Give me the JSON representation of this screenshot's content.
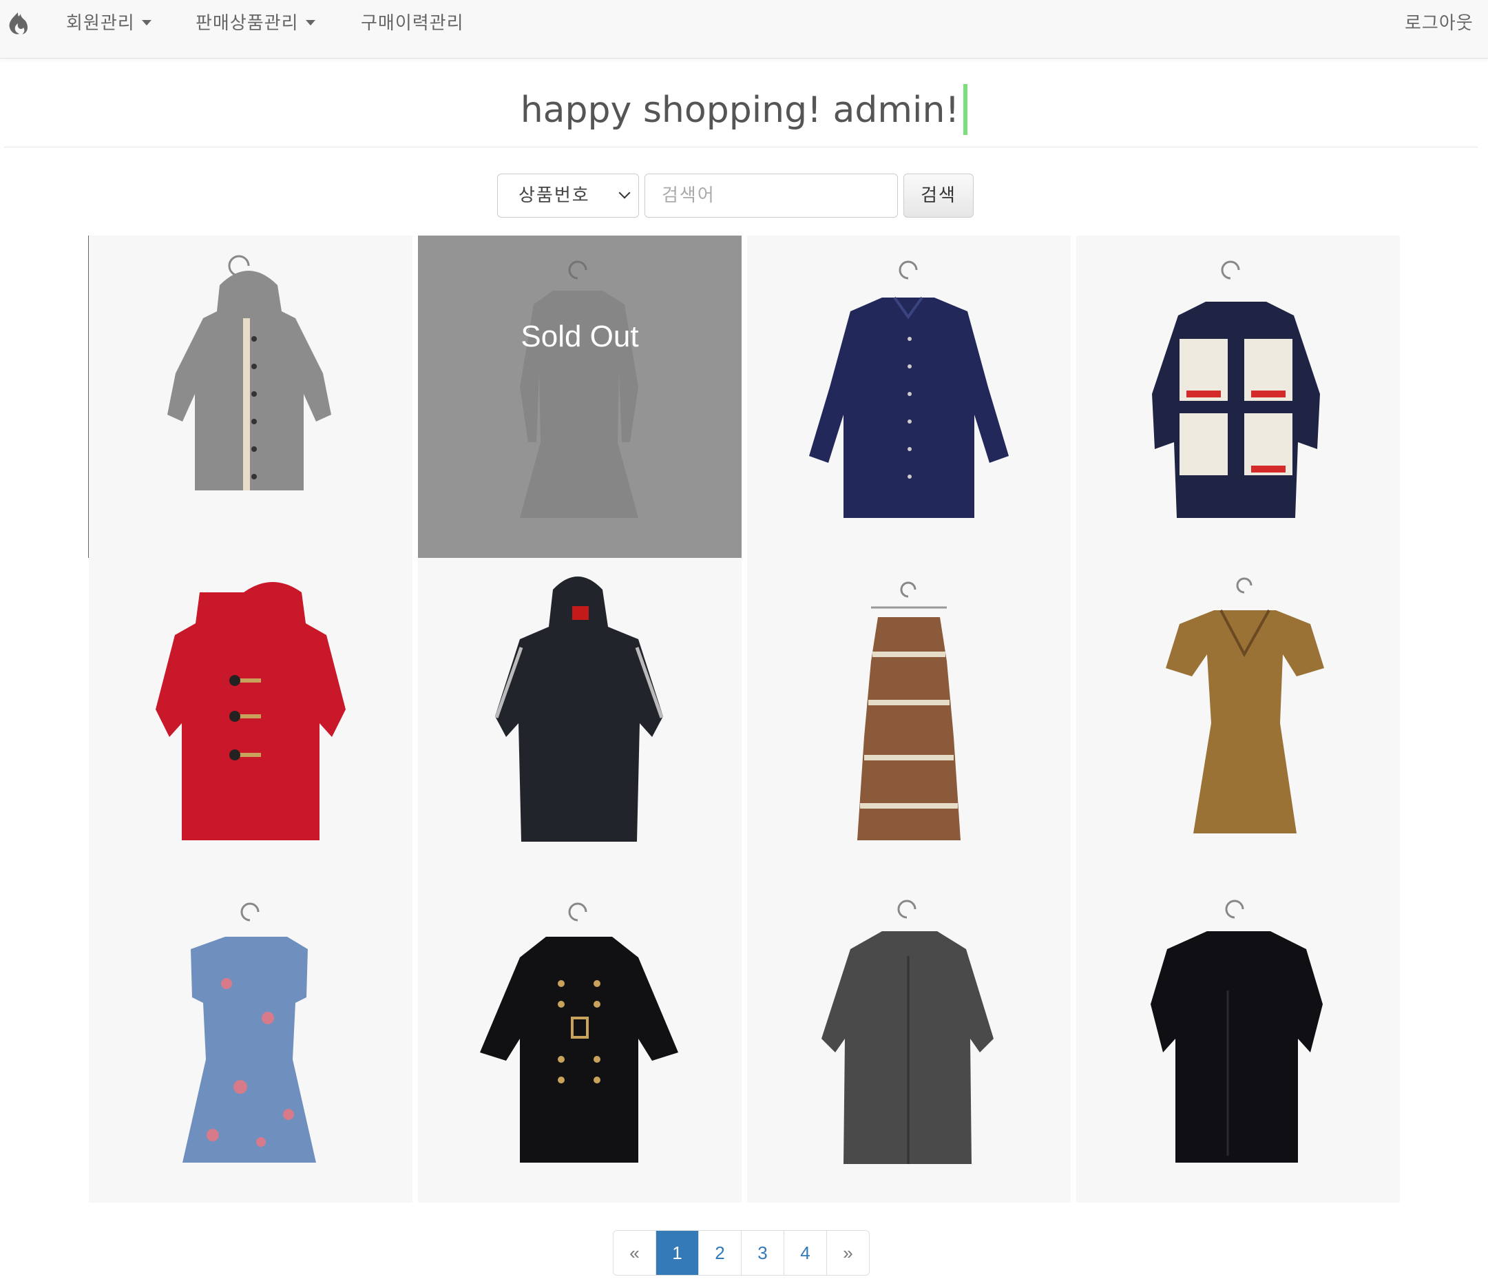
{
  "navbar": {
    "brand_icon": "flame-icon",
    "menu": [
      {
        "label": "회원관리",
        "dropdown": true
      },
      {
        "label": "판매상품관리",
        "dropdown": true
      },
      {
        "label": "구매이력관리",
        "dropdown": false
      }
    ],
    "logout": "로그아웃"
  },
  "hero": {
    "text": "happy shopping! admin!"
  },
  "search": {
    "select_value": "상품번호",
    "placeholder": "검색어",
    "button": "검색"
  },
  "products": [
    {
      "item": "grey hooded cardigan",
      "color": "#8c8c8c",
      "sold_out": false
    },
    {
      "item": "grey suit",
      "color": "#8a8a8a",
      "sold_out": true,
      "badge": "Sold Out"
    },
    {
      "item": "navy shirt",
      "color": "#22295a",
      "sold_out": false
    },
    {
      "item": "navy snoopy cardigan",
      "color": "#1f2444",
      "sold_out": false
    },
    {
      "item": "red duffle coat",
      "color": "#c9182a",
      "sold_out": false
    },
    {
      "item": "black hooded jacket",
      "color": "#22242c",
      "sold_out": false
    },
    {
      "item": "paisley dress",
      "color": "#8a5a3a",
      "sold_out": false
    },
    {
      "item": "brown print dress",
      "color": "#9a7236",
      "sold_out": false
    },
    {
      "item": "blue floral dress",
      "color": "#6f8fbf",
      "sold_out": false
    },
    {
      "item": "black peacoat",
      "color": "#111114",
      "sold_out": false
    },
    {
      "item": "grey overcoat",
      "color": "#4a4a4a",
      "sold_out": false
    },
    {
      "item": "black long coat",
      "color": "#0f0f14",
      "sold_out": false
    }
  ],
  "pagination": {
    "prev": "«",
    "pages": [
      "1",
      "2",
      "3",
      "4"
    ],
    "active": "1",
    "next": "»"
  },
  "colors": {
    "accent": "#337ab7",
    "cursor": "#7be07b",
    "navbar_bg": "#f8f8f8"
  }
}
